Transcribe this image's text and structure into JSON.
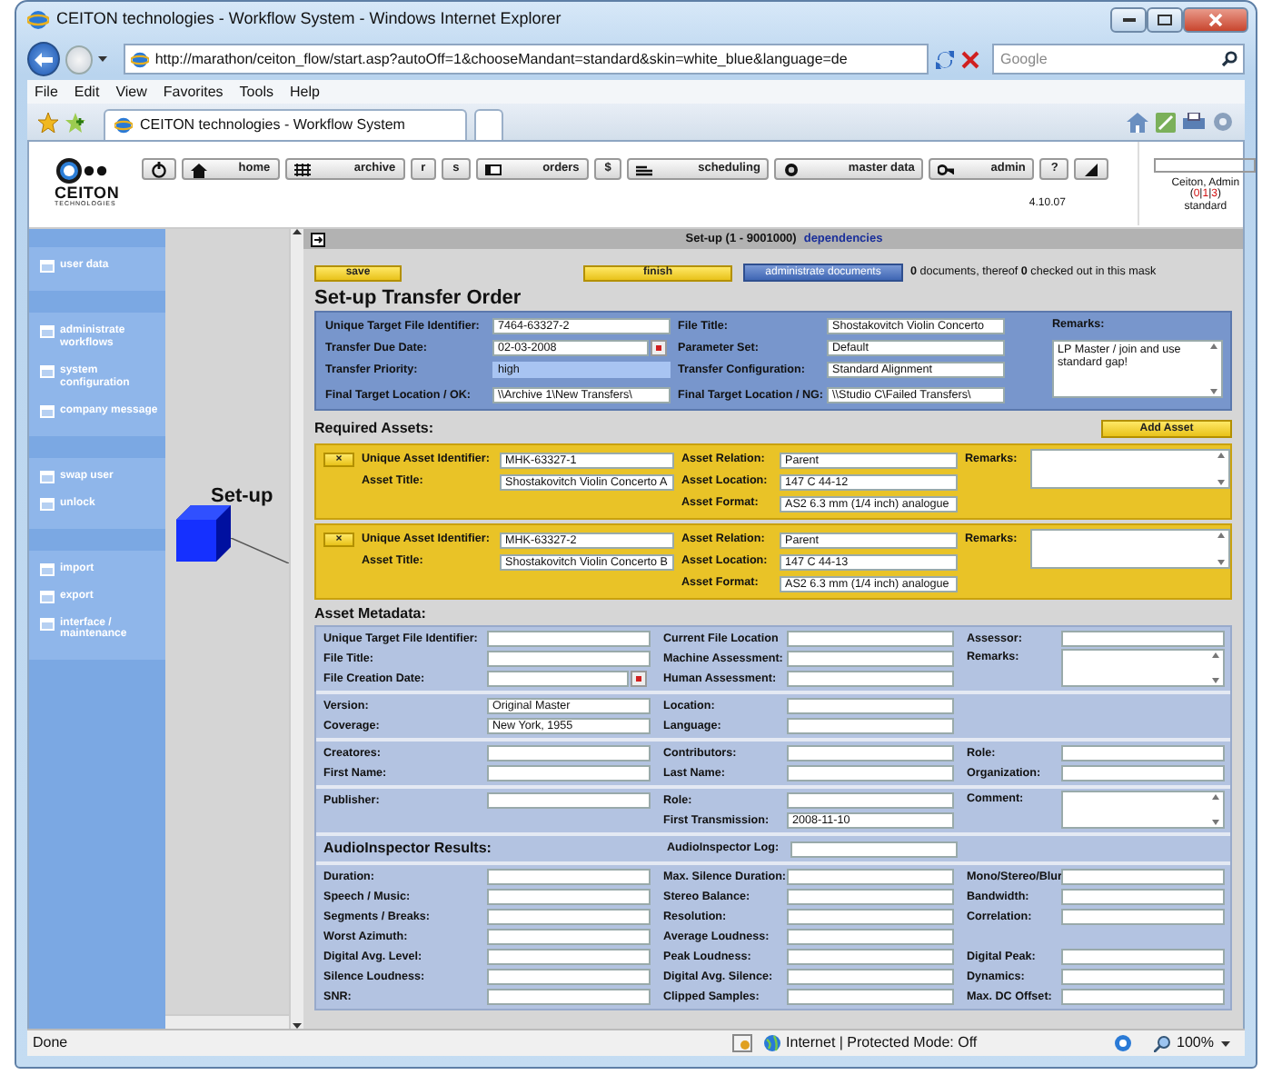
{
  "window": {
    "title": "CEITON technologies - Workflow System - Windows Internet Explorer"
  },
  "browser": {
    "address": "http://marathon/ceiton_flow/start.asp?autoOff=1&chooseMandant=standard&skin=white_blue&language=de",
    "search_placeholder": "Google",
    "menu": [
      "File",
      "Edit",
      "View",
      "Favorites",
      "Tools",
      "Help"
    ],
    "tab_title": "CEITON technologies - Workflow System",
    "status": "Done",
    "zone": "Internet | Protected Mode: Off",
    "zoom": "100%"
  },
  "header": {
    "logo": "CEITON",
    "logo_sub": "TECHNOLOGIES",
    "nav": [
      {
        "kind": "icon"
      },
      {
        "kind": "labeled",
        "label": "home"
      },
      {
        "kind": "labeled",
        "label": "archive"
      },
      {
        "kind": "plain",
        "label": "r"
      },
      {
        "kind": "plain",
        "label": "s"
      },
      {
        "kind": "labeled",
        "label": "orders"
      },
      {
        "kind": "plain",
        "label": "$"
      },
      {
        "kind": "labeled",
        "label": "scheduling"
      },
      {
        "kind": "labeled",
        "label": "master data"
      },
      {
        "kind": "labeled",
        "label": "admin"
      },
      {
        "kind": "plain",
        "label": "?"
      },
      {
        "kind": "icon"
      }
    ],
    "version": "4.10.07",
    "user": "Ceiton, Admin",
    "counts": [
      {
        "kind": "punct",
        "text": "("
      },
      {
        "kind": "count",
        "text": "0"
      },
      {
        "kind": "punct",
        "text": "|"
      },
      {
        "kind": "count",
        "text": "1"
      },
      {
        "kind": "punct",
        "text": "|"
      },
      {
        "kind": "count",
        "text": "3"
      },
      {
        "kind": "punct",
        "text": ")"
      }
    ],
    "mandant": "standard"
  },
  "sidebar": {
    "groups": [
      {
        "items": [
          "user data"
        ]
      },
      {
        "items": [
          "administrate workflows",
          "system configuration",
          "company message"
        ]
      },
      {
        "items": [
          "swap user",
          "unlock"
        ]
      },
      {
        "items": [
          "import",
          "export",
          "interface / maintenance"
        ]
      }
    ]
  },
  "workflow": {
    "step": "Set-up"
  },
  "content": {
    "bar_title": "Set-up (1 - 9001000)",
    "bar_link": "dependencies",
    "buttons": [
      {
        "kind": "yellow",
        "label": "save"
      },
      {
        "kind": "yellow",
        "label": "finish"
      },
      {
        "kind": "blue",
        "label": "administrate documents"
      }
    ],
    "doc_info": "**0** documents, thereof **0** checked out in this mask",
    "form_title": "Set-up Transfer Order",
    "order_columns": [
      [
        {
          "label": "Unique Target File Identifier:",
          "value": "7464-63327-2",
          "kind": "text"
        },
        {
          "label": "Transfer Due Date:",
          "value": "02-03-2008",
          "kind": "date"
        },
        {
          "label": "Transfer Priority:",
          "value": "high",
          "kind": "select"
        },
        {
          "label": "Final Target Location / OK:",
          "value": "\\\\Archive 1\\New Transfers\\",
          "kind": "text"
        }
      ],
      [
        {
          "label": "File Title:",
          "value": "Shostakovitch Violin Concerto",
          "kind": "text"
        },
        {
          "label": "Parameter Set:",
          "value": "Default",
          "kind": "text"
        },
        {
          "label": "Transfer Configuration:",
          "value": "Standard Alignment",
          "kind": "text"
        },
        {
          "label": "Final Target Location / NG:",
          "value": "\\\\Studio C\\Failed Transfers\\",
          "kind": "text"
        }
      ]
    ],
    "order_remarks": {
      "label": "Remarks:",
      "value": "LP Master / join and use standard gap!"
    },
    "assets_title": "Required Assets:",
    "add_asset": "Add Asset",
    "assets": [
      {
        "remove": "×",
        "identifier": {
          "label": "Unique Asset Identifier:",
          "value": "MHK-63327-1"
        },
        "title": {
          "label": "Asset Title:",
          "value": "Shostakovitch Violin Concerto A"
        },
        "relation": {
          "label": "Asset Relation:",
          "value": "Parent"
        },
        "location": {
          "label": "Asset Location:",
          "value": "147 C 44-12"
        },
        "format": {
          "label": "Asset Format:",
          "value": "AS2 6.3 mm (1/4 inch) analogue"
        },
        "remarks": {
          "label": "Remarks:"
        }
      },
      {
        "remove": "×",
        "identifier": {
          "label": "Unique Asset Identifier:",
          "value": "MHK-63327-2"
        },
        "title": {
          "label": "Asset Title:",
          "value": "Shostakovitch Violin Concerto B"
        },
        "relation": {
          "label": "Asset Relation:",
          "value": "Parent"
        },
        "location": {
          "label": "Asset Location:",
          "value": "147 C 44-13"
        },
        "format": {
          "label": "Asset Format:",
          "value": "AS2 6.3 mm (1/4 inch) analogue"
        },
        "remarks": {
          "label": "Remarks:"
        }
      }
    ],
    "metadata_title": "Asset Metadata:",
    "metadata_sections": [
      {
        "columns": [
          [
            {
              "label": "Unique Target File Identifier:",
              "kind": "text"
            },
            {
              "label": "File Title:",
              "kind": "text"
            },
            {
              "label": "File Creation Date:",
              "kind": "date"
            }
          ],
          [
            {
              "label": "Current File Location",
              "kind": "text"
            },
            {
              "label": "Machine Assessment:",
              "kind": "text"
            },
            {
              "label": "Human Assessment:",
              "kind": "text"
            }
          ],
          [
            {
              "label": "Assessor:",
              "kind": "text"
            },
            {
              "label": "Remarks:",
              "kind": "area"
            }
          ]
        ]
      },
      {
        "columns": [
          [
            {
              "label": "Version:",
              "value": "Original Master",
              "kind": "text"
            },
            {
              "label": "Coverage:",
              "value": "New York, 1955",
              "kind": "text"
            }
          ],
          [
            {
              "label": "Location:",
              "kind": "text"
            },
            {
              "label": "Language:",
              "kind": "text"
            }
          ],
          []
        ]
      },
      {
        "columns": [
          [
            {
              "label": "Creatores:",
              "kind": "text"
            },
            {
              "label": "First Name:",
              "kind": "text"
            }
          ],
          [
            {
              "label": "Contributors:",
              "kind": "text"
            },
            {
              "label": "Last Name:",
              "kind": "text"
            }
          ],
          [
            {
              "label": "Role:",
              "kind": "text"
            },
            {
              "label": "Organization:",
              "kind": "text"
            }
          ]
        ]
      },
      {
        "columns": [
          [
            {
              "label": "Publisher:",
              "kind": "text"
            }
          ],
          [
            {
              "label": "Role:",
              "kind": "text"
            },
            {
              "label": "First Transmission:",
              "value": "2008-11-10",
              "kind": "text"
            }
          ],
          [
            {
              "label": "Comment:",
              "kind": "area"
            }
          ]
        ]
      }
    ],
    "inspector_title": "AudioInspector Results:",
    "inspector_log": {
      "label": "AudioInspector Log:"
    },
    "inspector_columns": [
      [
        {
          "label": "Duration:",
          "kind": "text"
        },
        {
          "label": "Speech / Music:",
          "kind": "text"
        },
        {
          "label": "Segments / Breaks:",
          "kind": "text"
        },
        {
          "label": "Worst Azimuth:",
          "kind": "text"
        },
        {
          "label": "Digital Avg. Level:",
          "kind": "text"
        },
        {
          "label": "Silence Loudness:",
          "kind": "text"
        },
        {
          "label": "SNR:",
          "kind": "text"
        }
      ],
      [
        {
          "label": "Max. Silence Duration:",
          "kind": "text"
        },
        {
          "label": "Stereo Balance:",
          "kind": "text"
        },
        {
          "label": "Resolution:",
          "kind": "text"
        },
        {
          "label": "Average Loudness:",
          "kind": "text"
        },
        {
          "label": "Peak Loudness:",
          "kind": "text"
        },
        {
          "label": "Digital Avg. Silence:",
          "kind": "text"
        },
        {
          "label": "Clipped Samples:",
          "kind": "text"
        }
      ],
      [
        {
          "label": "Mono/Stereo/Blur",
          "kind": "text"
        },
        {
          "label": "Bandwidth:",
          "kind": "text"
        },
        {
          "label": "Correlation:",
          "kind": "text"
        },
        {
          "kind": "empty"
        },
        {
          "label": "Digital Peak:",
          "kind": "text"
        },
        {
          "label": "Dynamics:",
          "kind": "text"
        },
        {
          "label": "Max. DC Offset:",
          "kind": "text"
        }
      ]
    ]
  }
}
